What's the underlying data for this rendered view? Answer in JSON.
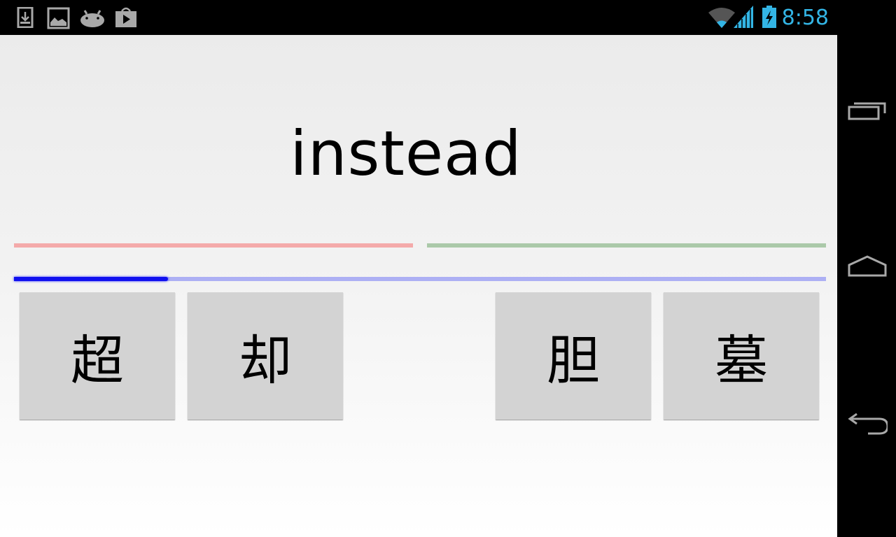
{
  "status_bar": {
    "notification_icons": [
      "download-icon",
      "image-icon",
      "android-icon",
      "play-store-icon"
    ],
    "system_icons": [
      "wifi-icon",
      "signal-icon",
      "battery-charging-icon"
    ],
    "time": "8:58",
    "accent_color": "#33b5e5"
  },
  "quiz": {
    "word": "instead",
    "choices": [
      "超",
      "却",
      "胆",
      "墓"
    ],
    "progress": 0.19,
    "colors": {
      "wrong_line": "#f4aaaa",
      "right_line": "#abc9a9",
      "progress_fill": "#1010ef",
      "progress_track": "#adb0f4"
    }
  },
  "nav_bar": {
    "buttons": [
      "recent-apps",
      "home",
      "back"
    ]
  }
}
